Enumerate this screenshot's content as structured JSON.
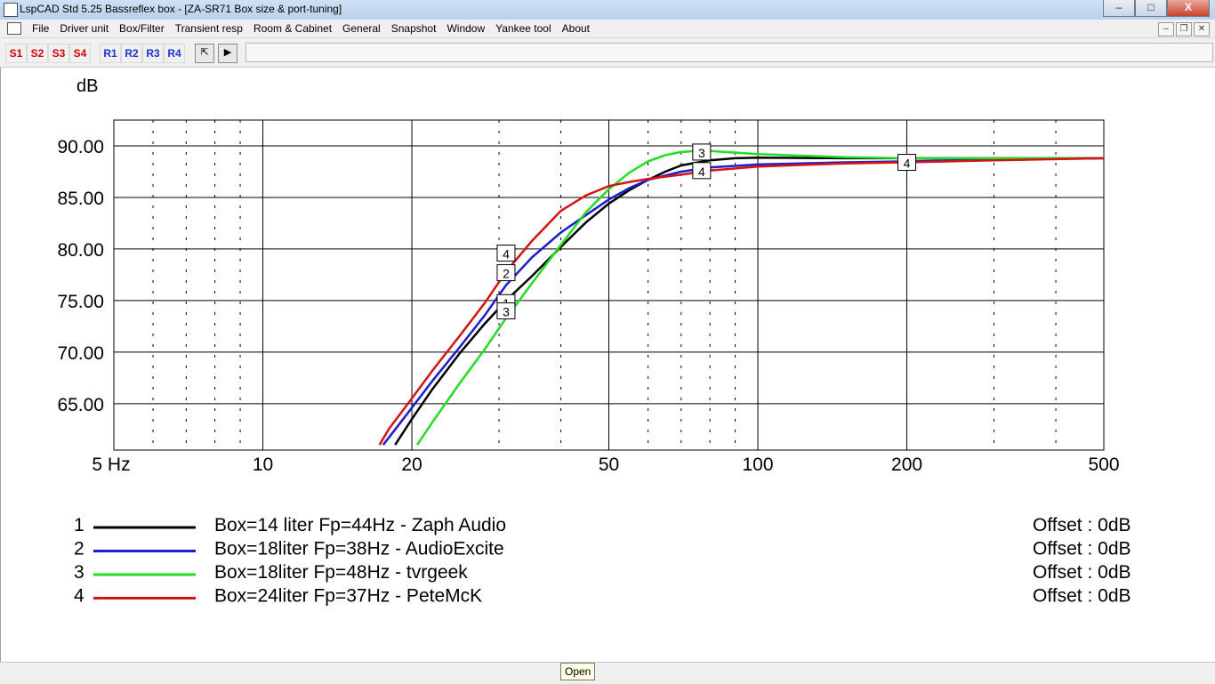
{
  "window": {
    "title": "LspCAD Std 5.25 Bassreflex box - [ZA-SR71 Box size & port-tuning]",
    "minimize_label": "–",
    "maximize_label": "□",
    "close_label": "X"
  },
  "menu": {
    "items": [
      "File",
      "Driver unit",
      "Box/Filter",
      "Transient resp",
      "Room & Cabinet",
      "General",
      "Snapshot",
      "Window",
      "Yankee tool",
      "About"
    ]
  },
  "toolbar": {
    "s_buttons": [
      "S1",
      "S2",
      "S3",
      "S4"
    ],
    "r_buttons": [
      "R1",
      "R2",
      "R3",
      "R4"
    ]
  },
  "tooltip": "Open",
  "colors": {
    "black": "#000000",
    "blue": "#1c1cd0",
    "green": "#22dd22",
    "red": "#d41414"
  },
  "chart_data": {
    "type": "line",
    "ylabel": "dB",
    "x_scale": "log",
    "xlim": [
      5,
      500
    ],
    "ylim": [
      60.5,
      92.5
    ],
    "x_ticks": [
      5,
      10,
      20,
      50,
      100,
      200,
      500
    ],
    "x_tick_labels": [
      "5 Hz",
      "10",
      "20",
      "50",
      "100",
      "200",
      "500"
    ],
    "y_ticks": [
      65,
      70,
      75,
      80,
      85,
      90
    ],
    "y_tick_labels": [
      "65.00",
      "70.00",
      "75.00",
      "80.00",
      "85.00",
      "90.00"
    ],
    "grid": true,
    "series": [
      {
        "id": "1",
        "name": "Box=14 liter Fp=44Hz - Zaph Audio",
        "offset": "Offset : 0dB",
        "color": "#000000",
        "points": [
          [
            18.5,
            61
          ],
          [
            20,
            63.5
          ],
          [
            22,
            66.4
          ],
          [
            25,
            69.9
          ],
          [
            28,
            72.7
          ],
          [
            31,
            75
          ],
          [
            35,
            77.4
          ],
          [
            40,
            80.2
          ],
          [
            45,
            82.6
          ],
          [
            50,
            84.4
          ],
          [
            55,
            85.7
          ],
          [
            60,
            86.7
          ],
          [
            65,
            87.5
          ],
          [
            70,
            88.1
          ],
          [
            80,
            88.6
          ],
          [
            90,
            88.8
          ],
          [
            100,
            88.85
          ],
          [
            150,
            88.8
          ],
          [
            200,
            88.8
          ],
          [
            300,
            88.8
          ],
          [
            500,
            88.8
          ]
        ]
      },
      {
        "id": "2",
        "name": "Box=18liter Fp=38Hz - AudioExcite",
        "offset": "Offset : 0dB",
        "color": "#1c1cd0",
        "points": [
          [
            17.5,
            61
          ],
          [
            19,
            63.2
          ],
          [
            20,
            64.6
          ],
          [
            22,
            67.2
          ],
          [
            25,
            70.5
          ],
          [
            28,
            73.5
          ],
          [
            31,
            76.5
          ],
          [
            35,
            79.2
          ],
          [
            40,
            81.6
          ],
          [
            45,
            83.3
          ],
          [
            50,
            84.8
          ],
          [
            55,
            85.9
          ],
          [
            60,
            86.7
          ],
          [
            70,
            87.5
          ],
          [
            80,
            87.9
          ],
          [
            100,
            88.2
          ],
          [
            150,
            88.4
          ],
          [
            200,
            88.5
          ],
          [
            300,
            88.7
          ],
          [
            500,
            88.8
          ]
        ]
      },
      {
        "id": "3",
        "name": "Box=18liter Fp=48Hz - tvrgeek",
        "offset": "Offset : 0dB",
        "color": "#22dd22",
        "points": [
          [
            20.5,
            61
          ],
          [
            22,
            63.2
          ],
          [
            25,
            67
          ],
          [
            28,
            70.2
          ],
          [
            31,
            73.3
          ],
          [
            35,
            76.7
          ],
          [
            40,
            80.4
          ],
          [
            45,
            83.6
          ],
          [
            50,
            85.8
          ],
          [
            55,
            87.4
          ],
          [
            60,
            88.5
          ],
          [
            65,
            89.1
          ],
          [
            70,
            89.4
          ],
          [
            75,
            89.5
          ],
          [
            80,
            89.5
          ],
          [
            100,
            89.2
          ],
          [
            150,
            88.9
          ],
          [
            200,
            88.8
          ],
          [
            300,
            88.8
          ],
          [
            500,
            88.8
          ]
        ]
      },
      {
        "id": "4",
        "name": "Box=24liter Fp=37Hz - PeteMcK",
        "offset": "Offset : 0dB",
        "color": "#d41414",
        "points": [
          [
            17.2,
            61
          ],
          [
            18,
            62.6
          ],
          [
            20,
            65.5
          ],
          [
            22,
            68.2
          ],
          [
            25,
            71.6
          ],
          [
            28,
            74.7
          ],
          [
            31,
            77.8
          ],
          [
            35,
            80.8
          ],
          [
            40,
            83.7
          ],
          [
            45,
            85.2
          ],
          [
            50,
            86.1
          ],
          [
            55,
            86.5
          ],
          [
            60,
            86.8
          ],
          [
            70,
            87.2
          ],
          [
            80,
            87.6
          ],
          [
            100,
            88
          ],
          [
            150,
            88.3
          ],
          [
            200,
            88.4
          ],
          [
            300,
            88.6
          ],
          [
            500,
            88.8
          ]
        ]
      }
    ],
    "markers": [
      {
        "label": "1",
        "x": 31,
        "y": 74.8
      },
      {
        "label": "3",
        "x": 31,
        "y": 74.0
      },
      {
        "label": "2",
        "x": 31,
        "y": 77.7
      },
      {
        "label": "4",
        "x": 31,
        "y": 79.6
      },
      {
        "label": "3",
        "x": 77,
        "y": 89.4
      },
      {
        "label": "4",
        "x": 77,
        "y": 87.6
      },
      {
        "label": "4",
        "x": 200,
        "y": 88.4
      }
    ]
  }
}
